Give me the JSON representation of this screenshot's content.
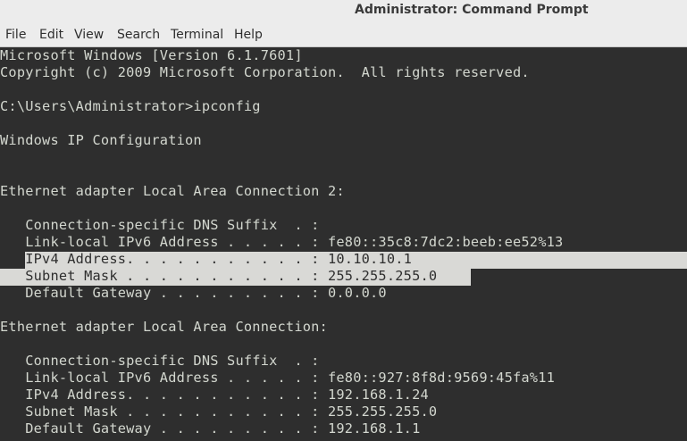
{
  "window": {
    "title": "Administrator: Command Prompt"
  },
  "menu": {
    "items": [
      "File",
      "Edit",
      "View",
      "Search",
      "Terminal",
      "Help"
    ]
  },
  "terminal": {
    "lines": [
      "Microsoft Windows [Version 6.1.7601]",
      "Copyright (c) 2009 Microsoft Corporation.  All rights reserved.",
      "",
      "C:\\Users\\Administrator>ipconfig",
      "",
      "Windows IP Configuration",
      "",
      "",
      "Ethernet adapter Local Area Connection 2:",
      "",
      "   Connection-specific DNS Suffix  . :",
      "   Link-local IPv6 Address . . . . . : fe80::35c8:7dc2:beeb:ee52%13",
      "   IPv4 Address. . . . . . . . . . . : 10.10.10.1",
      "   Subnet Mask . . . . . . . . . . . : 255.255.255.0",
      "   Default Gateway . . . . . . . . . : 0.0.0.0",
      "",
      "Ethernet adapter Local Area Connection:",
      "",
      "   Connection-specific DNS Suffix  . :",
      "   Link-local IPv6 Address . . . . . : fe80::927:8f8d:9569:45fa%11",
      "   IPv4 Address. . . . . . . . . . . : 192.168.1.24",
      "   Subnet Mask . . . . . . . . . . . : 255.255.255.0",
      "   Default Gateway . . . . . . . . . : 192.168.1.1"
    ]
  },
  "colors": {
    "terminal_bg": "#2e2e2e",
    "terminal_fg": "#d3d7cf",
    "selection_bg": "#d9d9d6",
    "chrome_bg": "#ececec"
  }
}
